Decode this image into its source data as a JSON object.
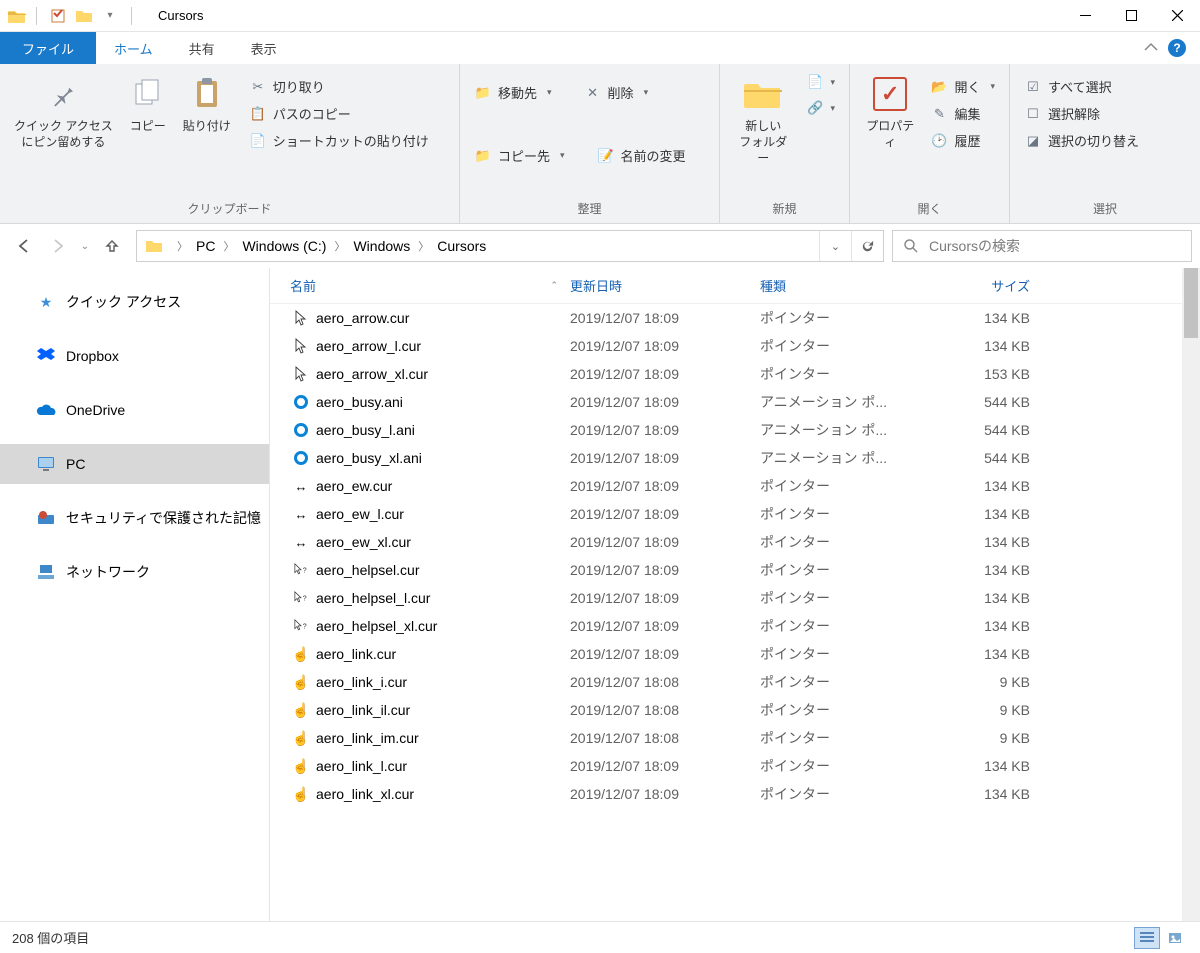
{
  "window": {
    "title": "Cursors"
  },
  "tabs": {
    "file": "ファイル",
    "home": "ホーム",
    "share": "共有",
    "view": "表示"
  },
  "ribbon": {
    "clipboard": {
      "pin": "クイック アクセス\nにピン留めする",
      "copy": "コピー",
      "paste": "貼り付け",
      "cut": "切り取り",
      "copy_path": "パスのコピー",
      "paste_shortcut": "ショートカットの貼り付け",
      "group_label": "クリップボード"
    },
    "organize": {
      "move_to": "移動先",
      "copy_to": "コピー先",
      "delete": "削除",
      "rename": "名前の変更",
      "group_label": "整理"
    },
    "new": {
      "new_folder": "新しい\nフォルダー",
      "group_label": "新規"
    },
    "open": {
      "properties": "プロパティ",
      "open": "開く",
      "edit": "編集",
      "history": "履歴",
      "group_label": "開く"
    },
    "select": {
      "select_all": "すべて選択",
      "select_none": "選択解除",
      "invert": "選択の切り替え",
      "group_label": "選択"
    }
  },
  "breadcrumbs": [
    "PC",
    "Windows (C:)",
    "Windows",
    "Cursors"
  ],
  "search": {
    "placeholder": "Cursorsの検索"
  },
  "sidebar": {
    "quick_access": "クイック アクセス",
    "dropbox": "Dropbox",
    "onedrive": "OneDrive",
    "pc": "PC",
    "security": "セキュリティで保護された記憶",
    "network": "ネットワーク"
  },
  "columns": {
    "name": "名前",
    "date": "更新日時",
    "type": "種類",
    "size": "サイズ"
  },
  "files": [
    {
      "icon": "arrow",
      "name": "aero_arrow.cur",
      "date": "2019/12/07 18:09",
      "type": "ポインター",
      "size": "134 KB"
    },
    {
      "icon": "arrow",
      "name": "aero_arrow_l.cur",
      "date": "2019/12/07 18:09",
      "type": "ポインター",
      "size": "134 KB"
    },
    {
      "icon": "arrow",
      "name": "aero_arrow_xl.cur",
      "date": "2019/12/07 18:09",
      "type": "ポインター",
      "size": "153 KB"
    },
    {
      "icon": "busy",
      "name": "aero_busy.ani",
      "date": "2019/12/07 18:09",
      "type": "アニメーション ポ...",
      "size": "544 KB"
    },
    {
      "icon": "busy",
      "name": "aero_busy_l.ani",
      "date": "2019/12/07 18:09",
      "type": "アニメーション ポ...",
      "size": "544 KB"
    },
    {
      "icon": "busy",
      "name": "aero_busy_xl.ani",
      "date": "2019/12/07 18:09",
      "type": "アニメーション ポ...",
      "size": "544 KB"
    },
    {
      "icon": "ew",
      "name": "aero_ew.cur",
      "date": "2019/12/07 18:09",
      "type": "ポインター",
      "size": "134 KB"
    },
    {
      "icon": "ew",
      "name": "aero_ew_l.cur",
      "date": "2019/12/07 18:09",
      "type": "ポインター",
      "size": "134 KB"
    },
    {
      "icon": "ew",
      "name": "aero_ew_xl.cur",
      "date": "2019/12/07 18:09",
      "type": "ポインター",
      "size": "134 KB"
    },
    {
      "icon": "help",
      "name": "aero_helpsel.cur",
      "date": "2019/12/07 18:09",
      "type": "ポインター",
      "size": "134 KB"
    },
    {
      "icon": "help",
      "name": "aero_helpsel_l.cur",
      "date": "2019/12/07 18:09",
      "type": "ポインター",
      "size": "134 KB"
    },
    {
      "icon": "help",
      "name": "aero_helpsel_xl.cur",
      "date": "2019/12/07 18:09",
      "type": "ポインター",
      "size": "134 KB"
    },
    {
      "icon": "link",
      "name": "aero_link.cur",
      "date": "2019/12/07 18:09",
      "type": "ポインター",
      "size": "134 KB"
    },
    {
      "icon": "link",
      "name": "aero_link_i.cur",
      "date": "2019/12/07 18:08",
      "type": "ポインター",
      "size": "9 KB"
    },
    {
      "icon": "link",
      "name": "aero_link_il.cur",
      "date": "2019/12/07 18:08",
      "type": "ポインター",
      "size": "9 KB"
    },
    {
      "icon": "link",
      "name": "aero_link_im.cur",
      "date": "2019/12/07 18:08",
      "type": "ポインター",
      "size": "9 KB"
    },
    {
      "icon": "link",
      "name": "aero_link_l.cur",
      "date": "2019/12/07 18:09",
      "type": "ポインター",
      "size": "134 KB"
    },
    {
      "icon": "link",
      "name": "aero_link_xl.cur",
      "date": "2019/12/07 18:09",
      "type": "ポインター",
      "size": "134 KB"
    }
  ],
  "status": {
    "item_count": "208 個の項目"
  }
}
